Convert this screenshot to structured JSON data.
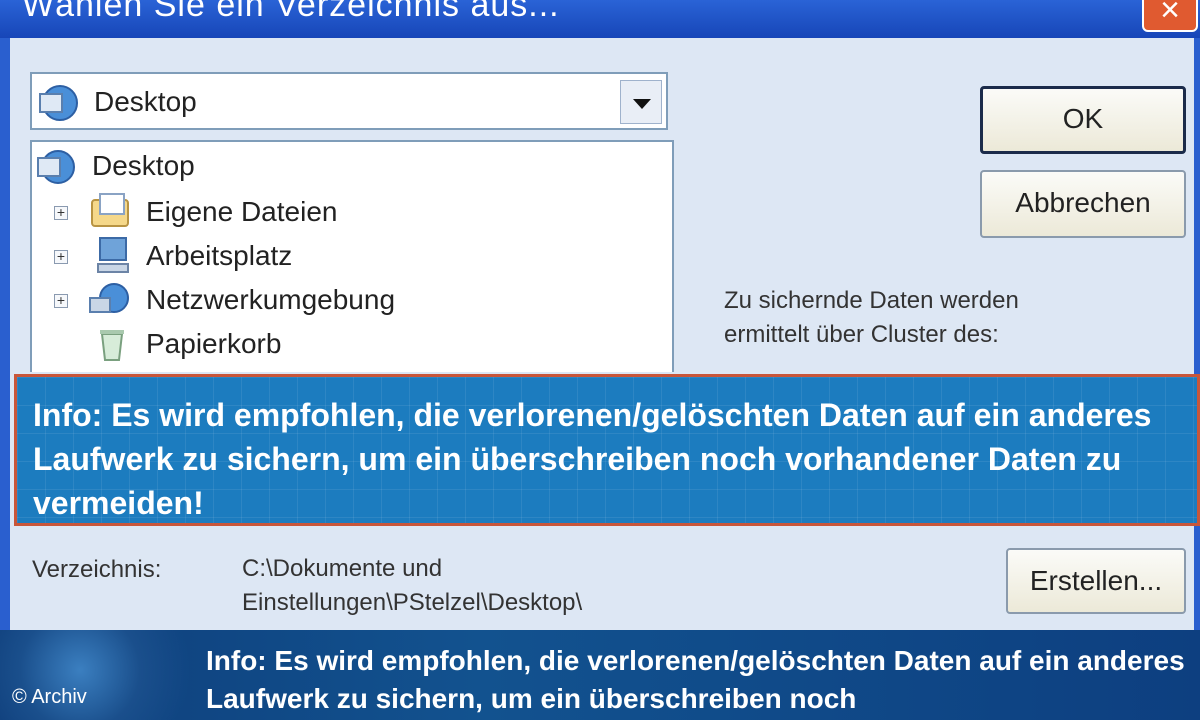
{
  "window": {
    "title": "Wählen Sie ein Verzeichnis aus...",
    "close_label": "×"
  },
  "folder_combo": {
    "selected": "Desktop"
  },
  "tree": {
    "items": [
      {
        "label": "Desktop",
        "icon": "desktop-icon",
        "expander": ""
      },
      {
        "label": "Eigene Dateien",
        "icon": "folder-icon",
        "expander": "+"
      },
      {
        "label": "Arbeitsplatz",
        "icon": "computer-icon",
        "expander": "+"
      },
      {
        "label": "Netzwerkumgebung",
        "icon": "network-icon",
        "expander": "+"
      },
      {
        "label": "Papierkorb",
        "icon": "recycle-bin-icon",
        "expander": ""
      }
    ]
  },
  "buttons": {
    "ok": "OK",
    "cancel": "Abbrechen",
    "create": "Erstellen..."
  },
  "info": {
    "line1": "Zu sichernde Daten werden",
    "line2": "ermittelt über Cluster des:"
  },
  "banner": {
    "text": "Info: Es wird empfohlen, die verlorenen/gelöschten Daten auf ein anderes Laufwerk zu sichern, um ein überschreiben noch vorhandener Daten zu vermeiden!"
  },
  "directory": {
    "label": "Verzeichnis:",
    "path_line1": "C:\\Dokumente und",
    "path_line2": "Einstellungen\\PStelzel\\Desktop\\"
  },
  "bottom_banner": {
    "text": "Info: Es wird empfohlen, die verlorenen/gelöschten Daten auf ein anderes Laufwerk zu sichern, um ein überschreiben noch"
  },
  "copyright": "© Archiv",
  "colors": {
    "titlebar": "#1746b8",
    "banner": "#1c7cbf",
    "banner_border": "#c8563a"
  }
}
